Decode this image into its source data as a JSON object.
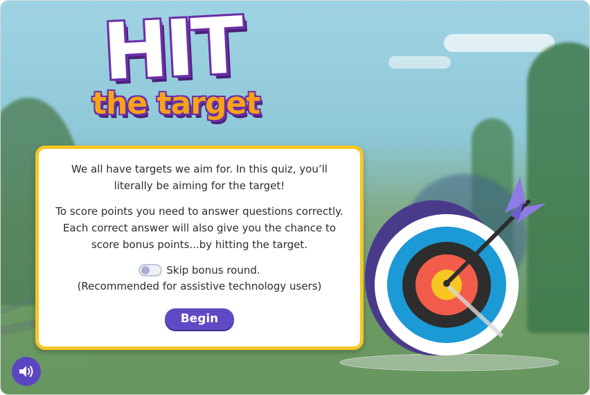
{
  "game": {
    "logo": {
      "title": "HIT",
      "subtitle": "the target"
    },
    "intro": {
      "paragraph1": "We all have targets we aim for. In this quiz, you’ll literally be aiming for the target!",
      "paragraph2": "To score points you need to answer questions correctly. Each correct answer will also give you the chance to score bonus points...by hitting the target.",
      "toggle_label": "Skip bonus round.",
      "toggle_on": false,
      "note": "(Recommended for assistive technology users)",
      "begin_label": "Begin"
    },
    "sound_button": {
      "icon": "speaker-icon"
    }
  },
  "colors": {
    "panel_border": "#f7c623",
    "button": "#6049c4",
    "logo_outline": "#6a2fa6",
    "logo_sub": "#f6a31a",
    "target_outer": "#ffffff",
    "target_blue": "#1c9ad6",
    "target_black": "#2d2d2d",
    "target_red": "#f25c4b",
    "target_yellow": "#f7c623",
    "arrow_fletching": "#8f7ae8"
  }
}
